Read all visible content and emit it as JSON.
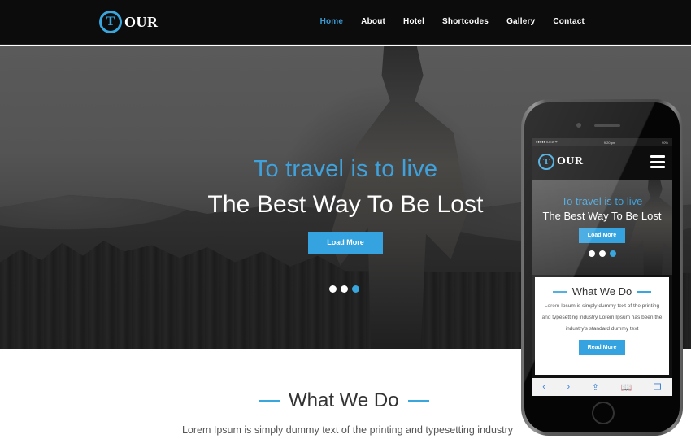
{
  "header": {
    "logo_letter": "T",
    "logo_text": "OUR",
    "nav": [
      {
        "label": "Home",
        "active": true
      },
      {
        "label": "About",
        "active": false
      },
      {
        "label": "Hotel",
        "active": false
      },
      {
        "label": "Shortcodes",
        "active": false
      },
      {
        "label": "Gallery",
        "active": false
      },
      {
        "label": "Contact",
        "active": false
      }
    ]
  },
  "hero": {
    "tagline": "To travel is to live",
    "title": "The Best Way To Be Lost",
    "button": "Load More",
    "slides": 3,
    "active_slide": 3
  },
  "what_we_do": {
    "title": "What We Do",
    "text": "Lorem Ipsum is simply dummy text of the printing and typesetting industry"
  },
  "phone": {
    "status": {
      "carrier": "●●●●● IDEA ᯤ",
      "time": "9:20 pm",
      "battery": "90%"
    },
    "logo_letter": "T",
    "logo_text": "OUR",
    "hero": {
      "tagline": "To travel is to live",
      "title": "The Best Way To Be Lost",
      "button": "Load More"
    },
    "what_we_do": {
      "title": "What We Do",
      "text": "Lorem Ipsum is simply dummy text of the printing and typesetting industry Lorem Ipsum has been the industry's standard dummy text",
      "button": "Read More"
    },
    "toolbar": {
      "back": "‹",
      "forward": "›",
      "share": "⇪",
      "bookmarks": "📖",
      "tabs": "❐"
    }
  },
  "colors": {
    "accent": "#3aa6de",
    "header_bg": "#0c0c0c"
  }
}
